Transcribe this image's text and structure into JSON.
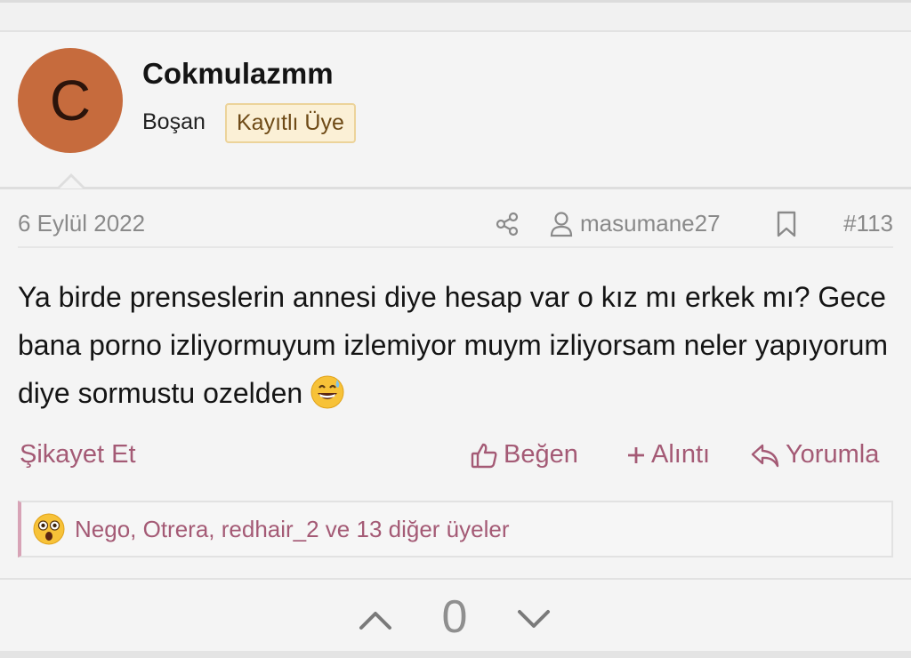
{
  "user": {
    "avatar_letter": "C",
    "avatar_color": "#c66b3d",
    "name": "Cokmulazmm",
    "title": "Boşan",
    "badge": "Kayıtlı Üye"
  },
  "post": {
    "date": "6 Eylül 2022",
    "author": "masumane27",
    "number": "#113",
    "body": "Ya birde prenseslerin annesi diye hesap var o kız mı erkek mı? Gece bana porno izliyormuyum izlemiyor muym izliyorsam neler yapıyorum diye sormustu ozelden",
    "body_emoji": "grinning-sweat-emoji"
  },
  "actions": {
    "report": "Şikayet Et",
    "like": "Beğen",
    "quote": "Alıntı",
    "reply": "Yorumla"
  },
  "reactions": {
    "emoji": "astonished-emoji",
    "text": "Nego, Otrera, redhair_2 ve 13 diğer üyeler"
  },
  "votes": {
    "count": "0"
  },
  "colors": {
    "accent": "#a45a75",
    "meta": "#8a8a8a"
  }
}
